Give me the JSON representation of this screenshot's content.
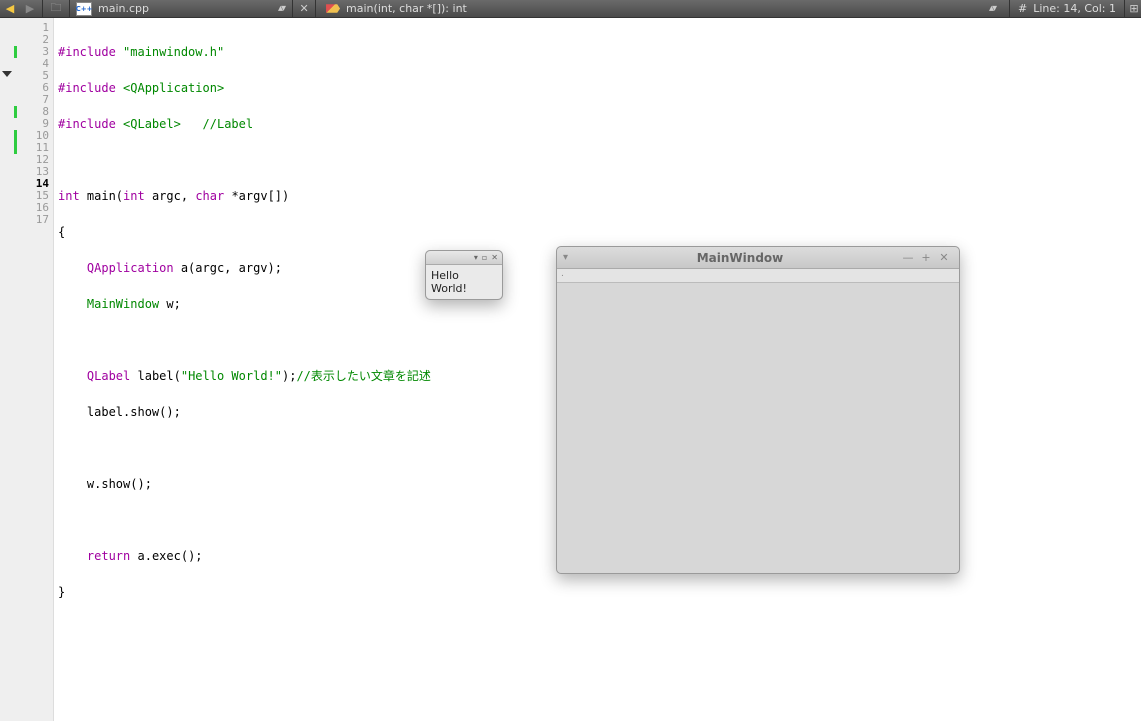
{
  "toolbar": {
    "file_tab": "main.cpp",
    "file_icon_text": "C++",
    "symbol_tab": "main(int, char *[]): int",
    "status": "Line: 14, Col: 1"
  },
  "gutter": {
    "lines": [
      "1",
      "2",
      "3",
      "4",
      "5",
      "6",
      "7",
      "8",
      "9",
      "10",
      "11",
      "12",
      "13",
      "14",
      "15",
      "16",
      "17"
    ],
    "current_line": 14,
    "fold_at": 5,
    "change_bars": [
      3,
      8,
      10,
      11
    ]
  },
  "code": {
    "l1_pre": "#include ",
    "l1_inc": "\"mainwindow.h\"",
    "l2_pre": "#include ",
    "l2_inc": "<QApplication>",
    "l3_pre": "#include ",
    "l3_inc": "<QLabel>",
    "l3_pad": "   ",
    "l3_cmt": "//Label",
    "l5_kw_int": "int",
    "l5_txt1": " main(",
    "l5_kw_int2": "int",
    "l5_txt2": " argc, ",
    "l5_kw_char": "char",
    "l5_txt3": " *argv[])",
    "l6": "{",
    "l7_pad": "    ",
    "l7_qa": "QApplication",
    "l7_rest": " a(argc, argv);",
    "l8_pad": "    ",
    "l8_mw": "MainWindow",
    "l8_rest": " w;",
    "l10_pad": "    ",
    "l10_ql": "QLabel",
    "l10_txt1": " label(",
    "l10_str": "\"Hello World!\"",
    "l10_txt2": ");",
    "l10_cmt": "//表示したい文章を記述",
    "l11": "    label.show();",
    "l13": "    w.show();",
    "l15_pad": "    ",
    "l15_kw": "return",
    "l15_rest": " a.exec();",
    "l16": "}"
  },
  "hello_window": {
    "text": "Hello World!"
  },
  "main_window": {
    "title": "MainWindow"
  }
}
